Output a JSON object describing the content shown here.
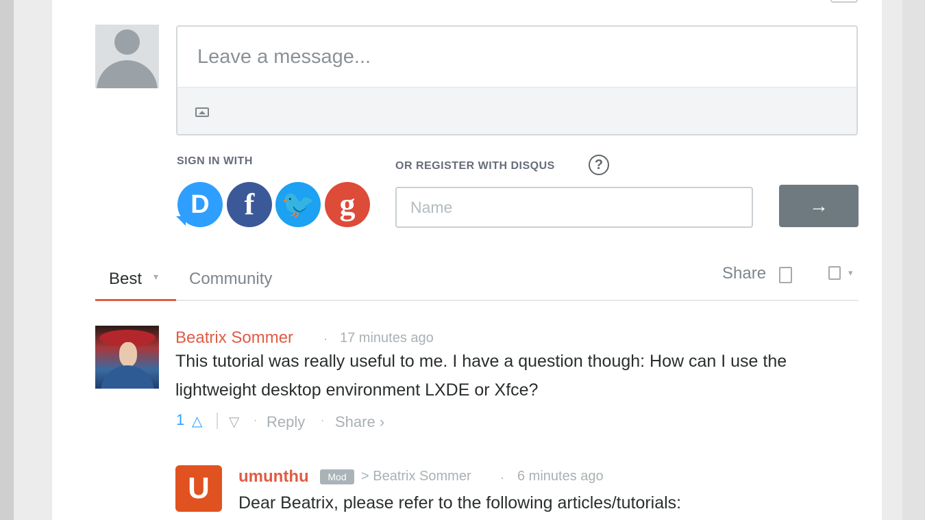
{
  "composer": {
    "placeholder": "Leave a message..."
  },
  "auth": {
    "sign_in_label": "SIGN IN WITH",
    "register_label": "OR REGISTER WITH DISQUS",
    "help_glyph": "?",
    "providers": [
      {
        "name": "disqus",
        "glyph": "D",
        "color": "#2e9fff"
      },
      {
        "name": "facebook",
        "glyph": "f",
        "color": "#3b5998"
      },
      {
        "name": "twitter",
        "glyph": "🐦",
        "color": "#1da1f2"
      },
      {
        "name": "google",
        "glyph": "g",
        "color": "#dd4b39"
      }
    ],
    "name_placeholder": "Name",
    "submit_glyph": "→"
  },
  "tabs": {
    "best_label": "Best",
    "best_caret": "▾",
    "community_label": "Community",
    "share_label": "Share",
    "settings_caret": "▾"
  },
  "comments": [
    {
      "author": "Beatrix Sommer",
      "separator": "·",
      "time": "17 minutes ago",
      "text": "This tutorial was really useful to me. I have a question though: How can I use the lightweight desktop environment LXDE or Xfce?",
      "votes": "1",
      "upvote_glyph": "△",
      "downvote_glyph": "▽",
      "reply_label": "Reply",
      "share_label": "Share ›",
      "dot": "·"
    },
    {
      "avatar_letter": "U",
      "author": "umunthu",
      "badge": "Mod",
      "reply_to": "> Beatrix Sommer",
      "separator": "·",
      "time": "6 minutes ago",
      "text": "Dear Beatrix, please refer to the following articles/tutorials:"
    }
  ],
  "colors": {
    "accent": "#e05c43",
    "link_blue": "#2e9fff",
    "button_gray": "#6f7a80"
  }
}
